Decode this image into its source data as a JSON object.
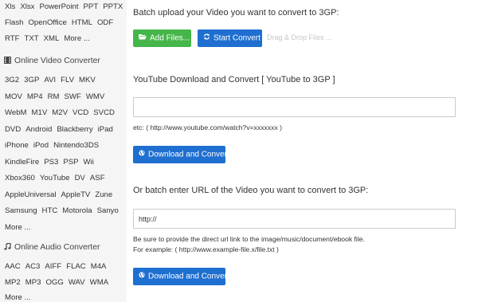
{
  "sidebar": {
    "doc_rows": [
      [
        "Xls",
        "Xlsx",
        "PowerPoint",
        "PPT",
        "PPTX"
      ],
      [
        "Flash",
        "OpenOffice",
        "HTML",
        "ODF"
      ],
      [
        "RTF",
        "TXT",
        "XML",
        "More ..."
      ]
    ],
    "video_header": "Online Video Converter",
    "video_rows": [
      [
        "3G2",
        "3GP",
        "AVI",
        "FLV",
        "MKV"
      ],
      [
        "MOV",
        "MP4",
        "RM",
        "SWF",
        "WMV"
      ],
      [
        "WebM",
        "M1V",
        "M2V",
        "VCD",
        "SVCD"
      ],
      [
        "DVD",
        "Android",
        "Blackberry",
        "iPad"
      ],
      [
        "iPhone",
        "iPod",
        "Nintendo3DS"
      ],
      [
        "KindleFire",
        "PS3",
        "PSP",
        "Wii"
      ],
      [
        "Xbox360",
        "YouTube",
        "DV",
        "ASF"
      ],
      [
        "AppleUniversal",
        "AppleTV",
        "Zune"
      ],
      [
        "Samsung",
        "HTC",
        "Motorola",
        "Sanyo"
      ],
      [
        "More ..."
      ]
    ],
    "audio_header": "Online Audio Converter",
    "audio_rows": [
      [
        "AAC",
        "AC3",
        "AIFF",
        "FLAC",
        "M4A"
      ],
      [
        "MP2",
        "MP3",
        "OGG",
        "WAV",
        "WMA"
      ],
      [
        "More ..."
      ]
    ]
  },
  "main": {
    "batch_title": "Batch upload your Video you want to convert to 3GP:",
    "add_files_label": "Add Files...",
    "start_convert_label": "Start Convert",
    "drag_drop_label": "Drag & Drop Files ...",
    "youtube_title": "YouTube Download and Convert [ YouTube to 3GP ]",
    "youtube_input_value": "",
    "youtube_example": "etc: ( http://www.youtube.com/watch?v=xxxxxxx )",
    "download_convert_label": "Download and Convert",
    "url_title": "Or batch enter URL of the Video you want to convert to 3GP:",
    "url_input_value": "http://",
    "url_note": "Be sure to provide the direct url link to the image/music/document/ebook file.",
    "url_example": "For example: ( http://www.example-file.x/file.txt )",
    "download_convert_label_2": "Download and Convert"
  },
  "colors": {
    "green_button": "#45b649",
    "blue_button": "#1e6fd0",
    "sidebar_bg": "#f5f5f5"
  },
  "icons": {
    "video_header": "film-icon",
    "audio_header": "music-note-icon",
    "add_files": "folder-open-icon",
    "start_convert": "refresh-icon",
    "download": "globe-icon"
  }
}
